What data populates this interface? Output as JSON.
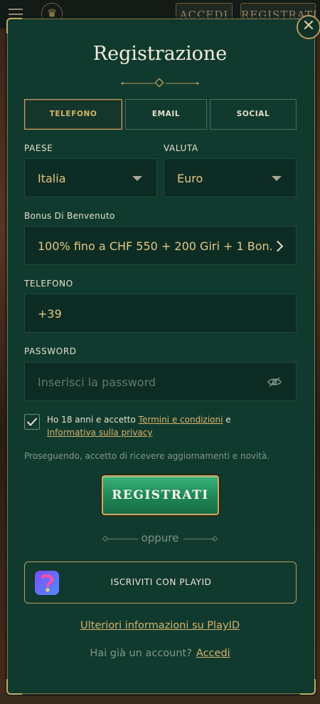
{
  "background": {
    "accedi_label": "ACCEDI",
    "registrati_label": "REGISTRATI"
  },
  "modal": {
    "title": "Registrazione",
    "close_icon": "close-icon",
    "tabs": [
      {
        "label": "TELEFONO",
        "active": true
      },
      {
        "label": "EMAIL",
        "active": false
      },
      {
        "label": "SOCIAL",
        "active": false
      }
    ],
    "country": {
      "label": "PAESE",
      "value": "Italia"
    },
    "currency": {
      "label": "VALUTA",
      "value": "Euro"
    },
    "bonus": {
      "label": "Bonus Di Benvenuto",
      "value": "100% fino a CHF 550 + 200 Giri + 1 Bon..."
    },
    "phone": {
      "label": "TELEFONO",
      "value": "+39"
    },
    "password": {
      "label": "PASSWORD",
      "placeholder": "Inserisci la password",
      "icon": "eye-slash-icon"
    },
    "consent": {
      "checked": true,
      "text_before": "Ho 18 anni e accetto ",
      "terms_link": "Termini e condizioni",
      "text_middle": " e",
      "privacy_link": "Informativa sulla privacy"
    },
    "notice": "Proseguendo, accetto di ricevere aggiornamenti e novità.",
    "register_button": "REGISTRATI",
    "separator": "oppure",
    "playid_button": "ISCRIVITI CON PLAYID",
    "more_info_link": "Ulteriori informazioni su PlayID",
    "have_account_text": "Hai già un account?",
    "login_link": "Accedi"
  },
  "colors": {
    "modal_bg": "#113a2f",
    "gold": "#d6b36a",
    "field_bg": "#0d2d24",
    "register_green": "#1f8a58"
  }
}
